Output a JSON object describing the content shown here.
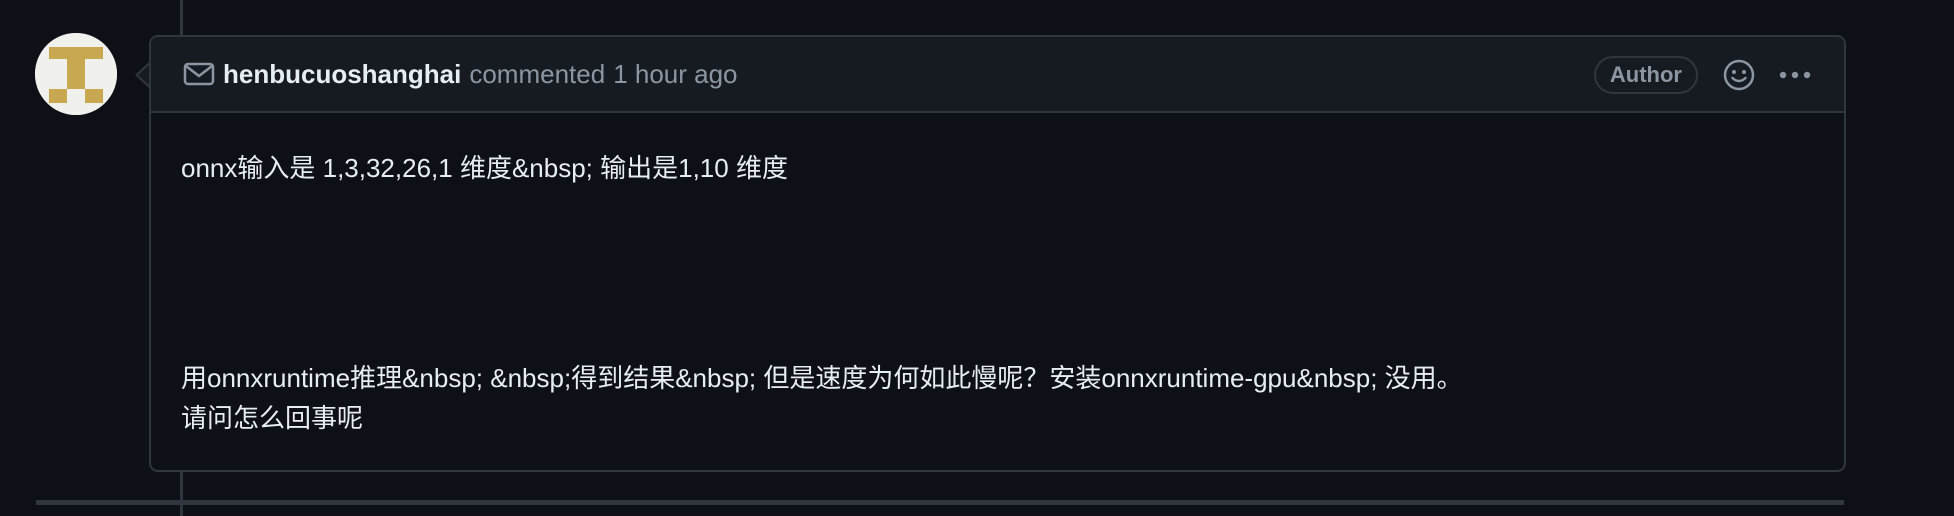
{
  "comment": {
    "author": "henbucuoshanghai",
    "action": "commented",
    "timestamp": "1 hour ago",
    "badge": "Author",
    "body": {
      "paragraph1": "onnx输入是 1,3,32,26,1 维度&nbsp; 输出是1,10 维度",
      "paragraph2_line1": "用onnxruntime推理&nbsp; &nbsp;得到结果&nbsp; 但是速度为何如此慢呢？安装onnxruntime-gpu&nbsp; 没用。",
      "paragraph2_line2": "请问怎么回事呢"
    }
  },
  "icons": {
    "header_left": "mail-icon",
    "reaction": "smiley-icon",
    "menu": "kebab-horizontal-icon"
  },
  "colors": {
    "background": "#0d1117",
    "header_background": "#161b22",
    "border": "#30363d",
    "text_primary": "#e6edf3",
    "text_muted": "#8d96a0",
    "avatar_gold": "#c8a951"
  }
}
